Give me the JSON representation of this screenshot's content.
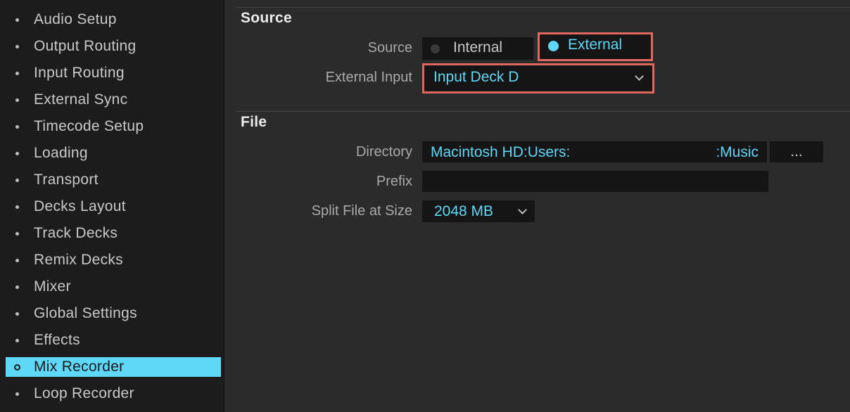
{
  "sidebar": {
    "items": [
      {
        "label": "Audio Setup"
      },
      {
        "label": "Output Routing"
      },
      {
        "label": "Input Routing"
      },
      {
        "label": "External Sync"
      },
      {
        "label": "Timecode Setup"
      },
      {
        "label": "Loading"
      },
      {
        "label": "Transport"
      },
      {
        "label": "Decks Layout"
      },
      {
        "label": "Track Decks"
      },
      {
        "label": "Remix Decks"
      },
      {
        "label": "Mixer"
      },
      {
        "label": "Global Settings"
      },
      {
        "label": "Effects"
      },
      {
        "label": "Mix Recorder"
      },
      {
        "label": "Loop Recorder"
      }
    ],
    "selected": "Mix Recorder"
  },
  "source_section": {
    "title": "Source",
    "source_label": "Source",
    "source_options": [
      "Internal",
      "External"
    ],
    "source_selected": "External",
    "external_input_label": "External Input",
    "external_input_value": "Input Deck D"
  },
  "file_section": {
    "title": "File",
    "directory_label": "Directory",
    "directory_value_left": "Macintosh HD:Users:",
    "directory_value_right": ":Music",
    "browse_label": "...",
    "prefix_label": "Prefix",
    "prefix_value": "",
    "split_label": "Split File at Size",
    "split_value": "2048 MB"
  },
  "colors": {
    "accent": "#5fd7f7",
    "highlight": "#e0685f"
  }
}
